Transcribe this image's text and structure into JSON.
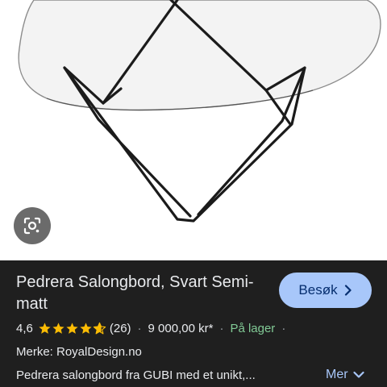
{
  "image": {
    "alt": "Pedrera Salongbord, Svart Semi-matt",
    "lens_icon": "google-lens-icon"
  },
  "product": {
    "title": "Pedrera Salongbord, Svart Semi-matt",
    "visit_label": "Besøk",
    "visit_icon": "chevron-right-icon",
    "rating": "4,6",
    "rating_value": 4.6,
    "review_count": "(26)",
    "price": "9 000,00 kr*",
    "stock_dot": "·",
    "stock": "På lager",
    "trailing_dot": "·",
    "brand": "Merke: RoyalDesign.no",
    "description": "Pedrera salongbord fra GUBI med et unikt,...",
    "more_label": "Mer",
    "more_icon": "chevron-down-icon"
  },
  "colors": {
    "panel_bg": "#1f1f1f",
    "text": "#e8eaed",
    "accent_button": "#a8c7fa",
    "accent_text": "#062e6f",
    "stock_green": "#81c995",
    "star_yellow": "#fbbc04"
  }
}
